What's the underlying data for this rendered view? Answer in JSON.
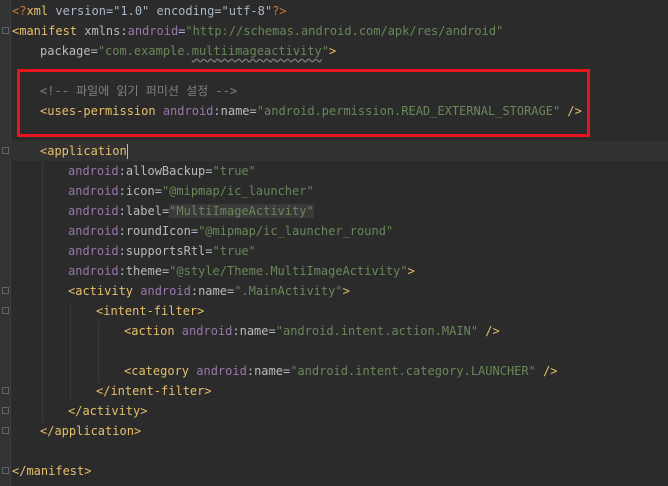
{
  "editor": {
    "lines": {
      "l1": {
        "pi_open": "<?",
        "tag": "xml",
        "text": " version=\"1.0\" encoding=\"utf-8\"",
        "pi_close": "?>"
      },
      "l2": {
        "open": "<manifest",
        "attr1": " xmlns:",
        "ns": "android",
        "eq": "=",
        "val": "\"http://schemas.android.com/apk/res/android\""
      },
      "l3": {
        "attr": "package",
        "eq": "=",
        "val_a": "\"com.example.",
        "val_b": "multiimageactivity",
        "val_c": "\"",
        "close": ">"
      },
      "l4": {
        "comment": "<!-- 파일에 읽기 퍼미션 설정 -->"
      },
      "l5": {
        "open": "<uses-permission",
        "ns": " android",
        "colon": ":",
        "attr": "name",
        "eq": "=",
        "val": "\"android.permission.READ_EXTERNAL_STORAGE\"",
        "close": " />"
      },
      "l6": {
        "open": "<application"
      },
      "l7": {
        "ns": "android",
        "colon": ":",
        "attr": "allowBackup",
        "eq": "=",
        "val": "\"true\""
      },
      "l8": {
        "ns": "android",
        "colon": ":",
        "attr": "icon",
        "eq": "=",
        "val": "\"@mipmap/ic_launcher\""
      },
      "l9": {
        "ns": "android",
        "colon": ":",
        "attr": "label",
        "eq": "=",
        "val": "\"MultiImageActivity\""
      },
      "l10": {
        "ns": "android",
        "colon": ":",
        "attr": "roundIcon",
        "eq": "=",
        "val": "\"@mipmap/ic_launcher_round\""
      },
      "l11": {
        "ns": "android",
        "colon": ":",
        "attr": "supportsRtl",
        "eq": "=",
        "val": "\"true\""
      },
      "l12": {
        "ns": "android",
        "colon": ":",
        "attr": "theme",
        "eq": "=",
        "val": "\"@style/Theme.MultiImageActivity\"",
        "close": ">"
      },
      "l13": {
        "open": "<activity",
        "ns": " android",
        "colon": ":",
        "attr": "name",
        "eq": "=",
        "val": "\".MainActivity\"",
        "close": ">"
      },
      "l14": {
        "open": "<intent-filter>"
      },
      "l15": {
        "open": "<action",
        "ns": " android",
        "colon": ":",
        "attr": "name",
        "eq": "=",
        "val": "\"android.intent.action.MAIN\"",
        "close": " />"
      },
      "l16": {
        "open": "<category",
        "ns": " android",
        "colon": ":",
        "attr": "name",
        "eq": "=",
        "val": "\"android.intent.category.LAUNCHER\"",
        "close": " />"
      },
      "l17": {
        "close": "</intent-filter>"
      },
      "l18": {
        "close": "</activity>"
      },
      "l19": {
        "close": "</application>"
      },
      "l20": {
        "close": "</manifest>"
      }
    },
    "highlight_color": "#e8141e"
  }
}
